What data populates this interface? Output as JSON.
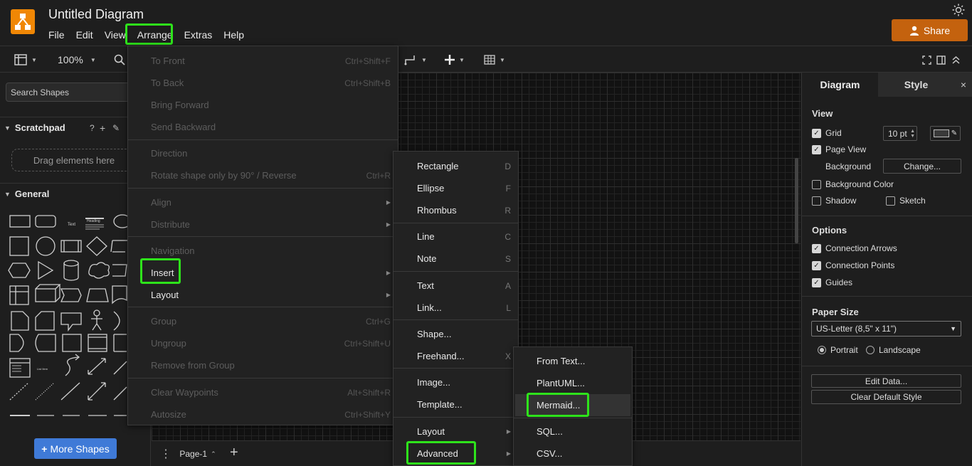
{
  "app": {
    "title": "Untitled Diagram",
    "menus": [
      "File",
      "Edit",
      "View",
      "Arrange",
      "Extras",
      "Help"
    ],
    "share_label": "Share"
  },
  "toolbar": {
    "zoom": "100%"
  },
  "sidebar": {
    "search_placeholder": "Search Shapes",
    "scratchpad_title": "Scratchpad",
    "scratchpad_help": "?",
    "dropzone_text": "Drag elements here",
    "general_title": "General",
    "shape_text_sample": "Text",
    "shape_heading_sample": "Heading",
    "shape_list_sample": "List Item",
    "more_shapes_label": "More Shapes"
  },
  "pages": {
    "current": "Page-1"
  },
  "format_panel": {
    "tab_diagram": "Diagram",
    "tab_style": "Style",
    "close": "×",
    "view_heading": "View",
    "grid_label": "Grid",
    "grid_size": "10 pt",
    "page_view_label": "Page View",
    "background_label": "Background",
    "change_label": "Change...",
    "background_color_label": "Background Color",
    "shadow_label": "Shadow",
    "sketch_label": "Sketch",
    "options_heading": "Options",
    "connection_arrows_label": "Connection Arrows",
    "connection_points_label": "Connection Points",
    "guides_label": "Guides",
    "paper_size_heading": "Paper Size",
    "paper_size_value": "US-Letter (8,5\" x 11\")",
    "portrait_label": "Portrait",
    "landscape_label": "Landscape",
    "edit_data_label": "Edit Data...",
    "clear_default_style_label": "Clear Default Style"
  },
  "arrange_menu": {
    "items": [
      {
        "label": "To Front",
        "shortcut": "Ctrl+Shift+F"
      },
      {
        "label": "To Back",
        "shortcut": "Ctrl+Shift+B"
      },
      {
        "label": "Bring Forward",
        "shortcut": ""
      },
      {
        "label": "Send Backward",
        "shortcut": ""
      },
      {
        "label": "Direction",
        "shortcut": ""
      },
      {
        "label": "Rotate shape only by 90° / Reverse",
        "shortcut": "Ctrl+R"
      },
      {
        "label": "Align",
        "shortcut": ""
      },
      {
        "label": "Distribute",
        "shortcut": ""
      },
      {
        "label": "Navigation",
        "shortcut": ""
      },
      {
        "label": "Insert",
        "shortcut": ""
      },
      {
        "label": "Layout",
        "shortcut": ""
      },
      {
        "label": "Group",
        "shortcut": "Ctrl+G"
      },
      {
        "label": "Ungroup",
        "shortcut": "Ctrl+Shift+U"
      },
      {
        "label": "Remove from Group",
        "shortcut": ""
      },
      {
        "label": "Clear Waypoints",
        "shortcut": "Alt+Shift+R"
      },
      {
        "label": "Autosize",
        "shortcut": "Ctrl+Shift+Y"
      }
    ]
  },
  "insert_menu": {
    "items": [
      {
        "label": "Rectangle",
        "shortcut": "D"
      },
      {
        "label": "Ellipse",
        "shortcut": "F"
      },
      {
        "label": "Rhombus",
        "shortcut": "R"
      },
      {
        "label": "Line",
        "shortcut": "C"
      },
      {
        "label": "Note",
        "shortcut": "S"
      },
      {
        "label": "Text",
        "shortcut": "A"
      },
      {
        "label": "Link...",
        "shortcut": "L"
      },
      {
        "label": "Shape...",
        "shortcut": ""
      },
      {
        "label": "Freehand...",
        "shortcut": "X"
      },
      {
        "label": "Image...",
        "shortcut": ""
      },
      {
        "label": "Template...",
        "shortcut": ""
      },
      {
        "label": "Layout",
        "shortcut": ""
      },
      {
        "label": "Advanced",
        "shortcut": ""
      }
    ]
  },
  "advanced_menu": {
    "items": [
      {
        "label": "From Text..."
      },
      {
        "label": "PlantUML..."
      },
      {
        "label": "Mermaid..."
      },
      {
        "label": "SQL..."
      },
      {
        "label": "CSV..."
      }
    ]
  },
  "colors": {
    "accent_highlight": "#2ee31b",
    "share": "#c4620e",
    "logo": "#f08705",
    "more_shapes": "#3f7ad7"
  }
}
